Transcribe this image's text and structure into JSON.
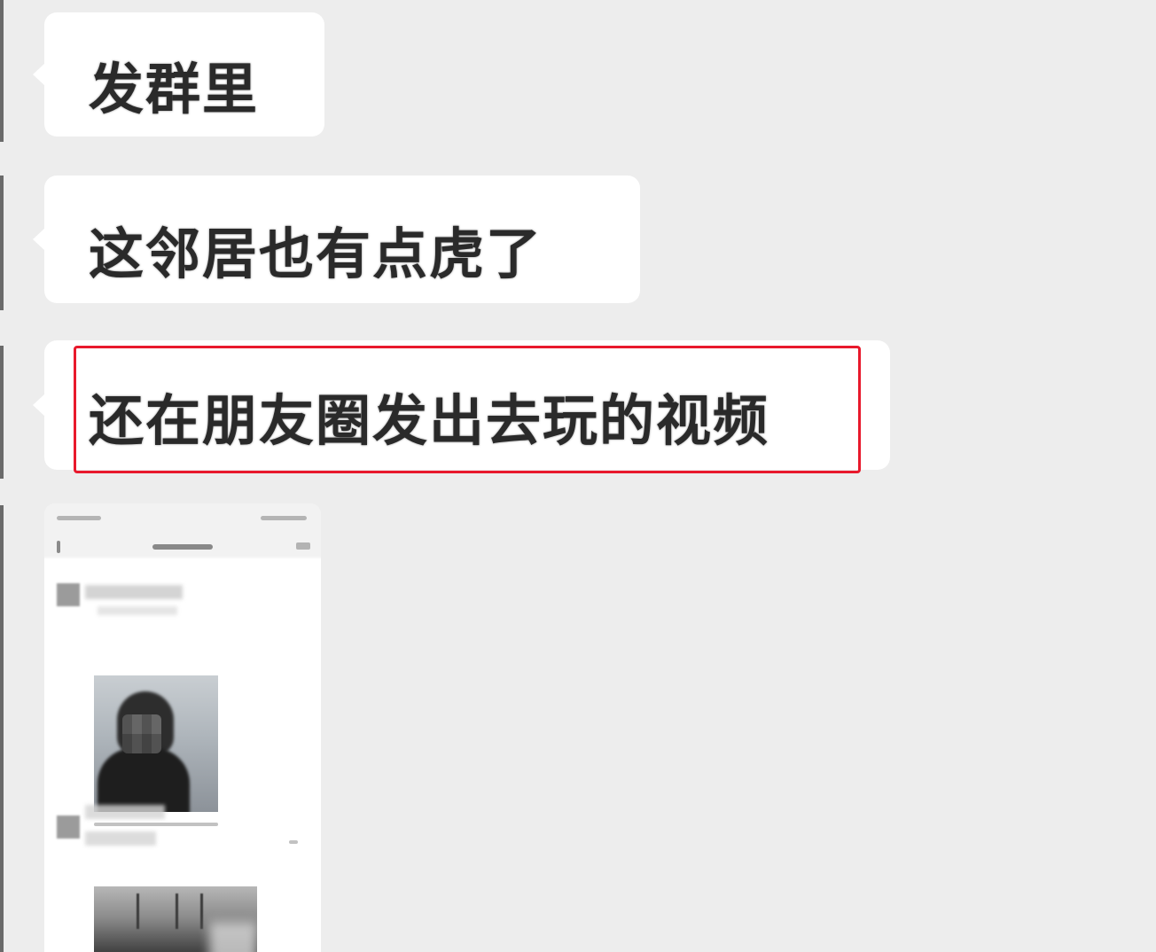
{
  "chat": {
    "messages": [
      {
        "type": "text",
        "text": "发群里"
      },
      {
        "type": "text",
        "text": "这邻居也有点虎了"
      },
      {
        "type": "text",
        "text": "还在朋友圈发出去玩的视频",
        "highlighted": true
      }
    ],
    "screenshot_message": {
      "description_visible": false
    }
  },
  "colors": {
    "background": "#ededed",
    "bubble": "#ffffff",
    "highlight_border": "#e8192c",
    "text": "#2a2a2a"
  }
}
